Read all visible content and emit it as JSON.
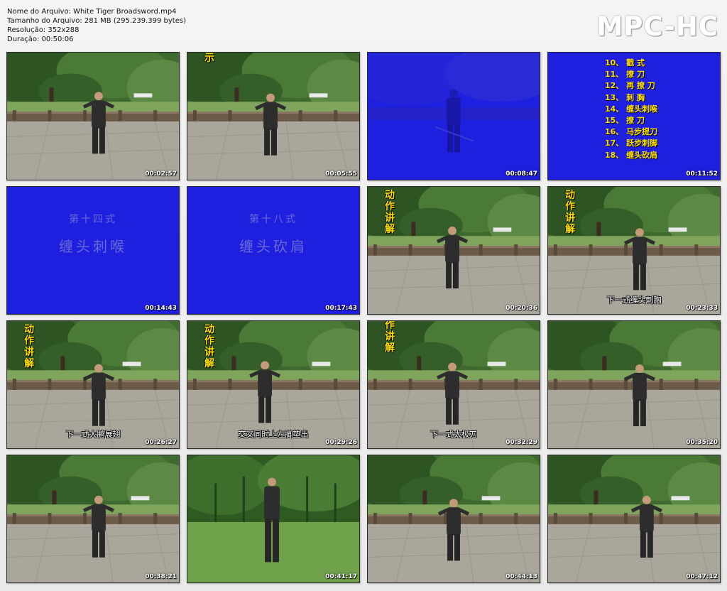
{
  "file_info": {
    "name": "Nome do Arquivo: White Tiger Broadsword.mp4",
    "size": "Tamanho do Arquivo: 281 MB (295.239.399 bytes)",
    "resolution": "Resolução: 352x288",
    "duration": "Duração: 00:50:06"
  },
  "brand": "MPC-HC",
  "colors": {
    "blue_card": "#1f1fe0",
    "caption_yellow": "#ffe000",
    "foliage": "#3f6a2f",
    "plaza": "#aaa69c"
  },
  "thumbnails": [
    {
      "time": "00:02:57",
      "type": "scene"
    },
    {
      "time": "00:05:55",
      "type": "scene",
      "caption": "示"
    },
    {
      "time": "00:08:47",
      "type": "blue-scene"
    },
    {
      "time": "00:11:52",
      "type": "list",
      "list": [
        "10、 戳 式",
        "11、 撩 刀",
        "12、 再 撩 刀",
        "13、 刺 胸",
        "14、 缠头刺喉",
        "15、 撩 刀",
        "16、 马步提刀",
        "17、 跃步刺脚",
        "18、 缠头砍肩"
      ]
    },
    {
      "time": "00:14:43",
      "type": "title",
      "line1": "第十四式",
      "line2": "缠头刺喉"
    },
    {
      "time": "00:17:43",
      "type": "title",
      "line1": "第十八式",
      "line2": "缠头砍肩"
    },
    {
      "time": "00:20:36",
      "type": "scene",
      "caption": "动作讲解"
    },
    {
      "time": "00:23:33",
      "type": "scene",
      "caption": "动作讲解",
      "subtitle": "下一式缠头刺胸"
    },
    {
      "time": "00:26:27",
      "type": "scene",
      "caption": "动作讲解",
      "subtitle": "下一式大鹏展翅"
    },
    {
      "time": "00:29:26",
      "type": "scene",
      "caption": "动作讲解",
      "subtitle": "交叉同时上左脚垫出"
    },
    {
      "time": "00:32:29",
      "type": "scene",
      "caption": "作讲解",
      "subtitle": "下一式太极刀"
    },
    {
      "time": "00:35:20",
      "type": "scene"
    },
    {
      "time": "00:38:21",
      "type": "scene"
    },
    {
      "time": "00:41:17",
      "type": "lawn"
    },
    {
      "time": "00:44:13",
      "type": "scene"
    },
    {
      "time": "00:47:12",
      "type": "scene"
    }
  ]
}
